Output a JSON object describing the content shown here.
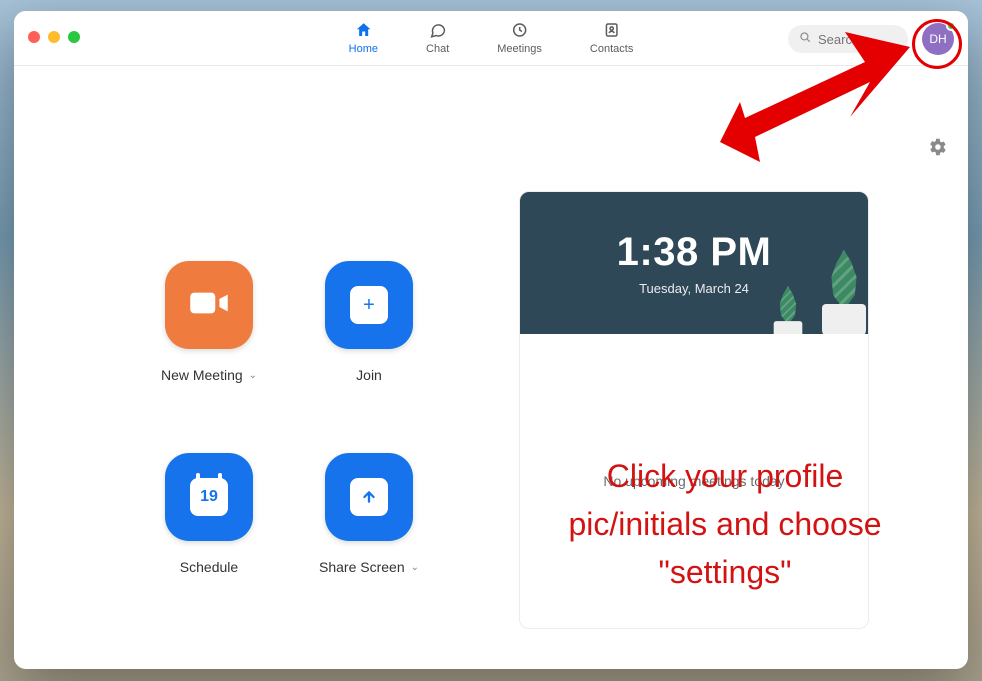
{
  "tabs": {
    "home": "Home",
    "chat": "Chat",
    "meetings": "Meetings",
    "contacts": "Contacts"
  },
  "search": {
    "placeholder": "Search"
  },
  "avatar": {
    "initials": "DH"
  },
  "actions": {
    "new_meeting": "New Meeting",
    "join": "Join",
    "schedule": "Schedule",
    "share_screen": "Share Screen",
    "calendar_day": "19",
    "plus": "+"
  },
  "panel": {
    "time": "1:38 PM",
    "date": "Tuesday, March 24",
    "empty": "No upcoming meetings today"
  },
  "annotation": {
    "text": "Click your profile pic/initials and choose \"settings\""
  }
}
